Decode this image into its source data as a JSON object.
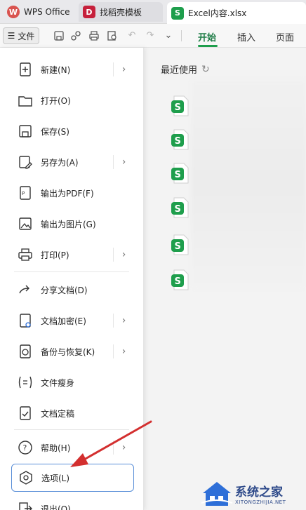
{
  "tabs": [
    {
      "label": "WPS Office",
      "icon": "wps-logo-icon"
    },
    {
      "label": "找稻壳模板",
      "icon": "docer-template-icon"
    },
    {
      "label": "Excel内容.xlsx",
      "icon": "spreadsheet-icon"
    }
  ],
  "toolbar": {
    "file_label": "文件",
    "ribbon_tabs": [
      "开始",
      "插入",
      "页面"
    ],
    "active_tab": "开始"
  },
  "menu": {
    "items": [
      {
        "label": "新建(N)",
        "icon": "new-document-icon",
        "has_submenu": true
      },
      {
        "label": "打开(O)",
        "icon": "folder-open-icon",
        "has_submenu": false
      },
      {
        "label": "保存(S)",
        "icon": "save-icon",
        "has_submenu": false
      },
      {
        "label": "另存为(A)",
        "icon": "save-as-icon",
        "has_submenu": true
      },
      {
        "label": "输出为PDF(F)",
        "icon": "export-pdf-icon",
        "has_submenu": false
      },
      {
        "label": "输出为图片(G)",
        "icon": "export-image-icon",
        "has_submenu": false
      },
      {
        "label": "打印(P)",
        "icon": "print-icon",
        "has_submenu": true
      },
      {
        "label": "分享文档(D)",
        "icon": "share-icon",
        "has_submenu": false
      },
      {
        "label": "文档加密(E)",
        "icon": "encrypt-icon",
        "has_submenu": true
      },
      {
        "label": "备份与恢复(K)",
        "icon": "backup-icon",
        "has_submenu": true
      },
      {
        "label": "文件瘦身",
        "icon": "slim-file-icon",
        "has_submenu": false
      },
      {
        "label": "文档定稿",
        "icon": "finalize-icon",
        "has_submenu": false
      },
      {
        "label": "帮助(H)",
        "icon": "help-icon",
        "has_submenu": true
      },
      {
        "label": "选项(L)",
        "icon": "settings-icon",
        "has_submenu": false,
        "selected": true
      },
      {
        "label": "退出(Q)",
        "icon": "exit-icon",
        "has_submenu": false
      }
    ]
  },
  "recent": {
    "title": "最近使用",
    "file_count": 6
  },
  "watermark": {
    "title": "系统之家",
    "url": "XITONGZHIJIA.NET"
  },
  "colors": {
    "accent_green": "#1e9e4c",
    "selection_border": "#5a8fd8",
    "annotation_arrow": "#d32f2f"
  }
}
